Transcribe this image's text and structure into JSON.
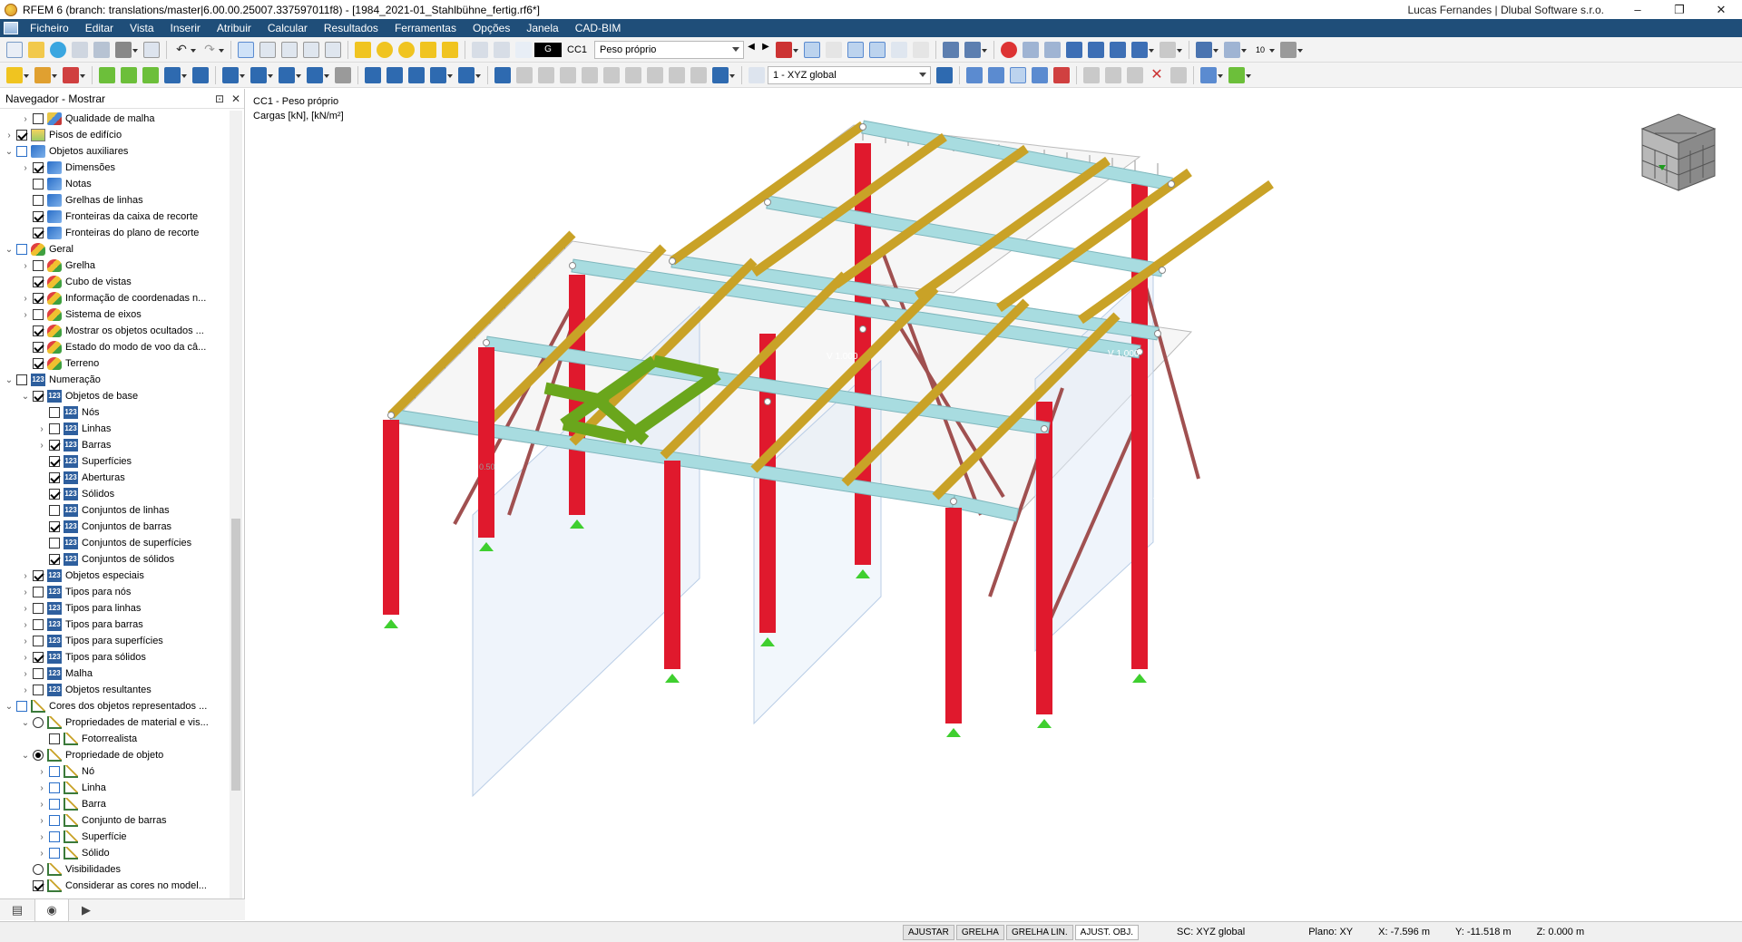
{
  "window": {
    "title": "RFEM 6 (branch: translations/master|6.00.00.25007.337597011f8) - [1984_2021-01_Stahlbühne_fertig.rf6*]",
    "user": "Lucas Fernandes | Dlubal Software s.r.o.",
    "controls": {
      "minimize": "–",
      "restore": "❐",
      "close": "✕"
    }
  },
  "menu": [
    "Ficheiro",
    "Editar",
    "Vista",
    "Inserir",
    "Atribuir",
    "Calcular",
    "Resultados",
    "Ferramentas",
    "Opções",
    "Janela",
    "CAD-BIM"
  ],
  "toolbar": {
    "load_case_tag": "G",
    "load_case_id": "CC1",
    "load_case_name": "Peso próprio",
    "coordinate_system": "1 - XYZ global",
    "numbers_label": "10"
  },
  "navigator": {
    "title": "Navegador - Mostrar",
    "pin": "⊡",
    "close": "✕",
    "items": [
      {
        "level": 1,
        "exp": "›",
        "check": "off",
        "icon": "hm",
        "label": "Qualidade de malha"
      },
      {
        "level": 0,
        "exp": "›",
        "check": "on",
        "icon": "pis",
        "label": "Pisos de edifício"
      },
      {
        "level": 0,
        "exp": "⌄",
        "check": "blue",
        "icon": "bl",
        "label": "Objetos auxiliares"
      },
      {
        "level": 1,
        "exp": "›",
        "check": "on",
        "icon": "bl",
        "label": "Dimensões"
      },
      {
        "level": 1,
        "exp": "",
        "check": "off",
        "icon": "bl",
        "label": "Notas"
      },
      {
        "level": 1,
        "exp": "",
        "check": "off",
        "icon": "bl",
        "label": "Grelhas de linhas"
      },
      {
        "level": 1,
        "exp": "",
        "check": "on",
        "icon": "bl",
        "label": "Fronteiras da caixa de recorte"
      },
      {
        "level": 1,
        "exp": "",
        "check": "on",
        "icon": "bl",
        "label": "Fronteiras do plano de recorte"
      },
      {
        "level": 0,
        "exp": "⌄",
        "check": "blue",
        "icon": "gr",
        "label": "Geral"
      },
      {
        "level": 1,
        "exp": "›",
        "check": "off",
        "icon": "gr",
        "label": "Grelha"
      },
      {
        "level": 1,
        "exp": "",
        "check": "on",
        "icon": "gr",
        "label": "Cubo de vistas"
      },
      {
        "level": 1,
        "exp": "›",
        "check": "on",
        "icon": "gr",
        "label": "Informação de coordenadas n..."
      },
      {
        "level": 1,
        "exp": "›",
        "check": "off",
        "icon": "gr",
        "label": "Sistema de eixos"
      },
      {
        "level": 1,
        "exp": "",
        "check": "on",
        "icon": "gr",
        "label": "Mostrar os objetos ocultados ..."
      },
      {
        "level": 1,
        "exp": "",
        "check": "on",
        "icon": "gr",
        "label": "Estado do modo de voo da câ..."
      },
      {
        "level": 1,
        "exp": "",
        "check": "on",
        "icon": "gr",
        "label": "Terreno"
      },
      {
        "level": 0,
        "exp": "⌄",
        "check": "off",
        "icon": "n123",
        "label": "Numeração"
      },
      {
        "level": 1,
        "exp": "⌄",
        "check": "on",
        "icon": "n123",
        "label": "Objetos de base"
      },
      {
        "level": 2,
        "exp": "",
        "check": "off",
        "icon": "n123",
        "label": "Nós"
      },
      {
        "level": 2,
        "exp": "›",
        "check": "off",
        "icon": "n123",
        "label": "Linhas"
      },
      {
        "level": 2,
        "exp": "›",
        "check": "on",
        "icon": "n123",
        "label": "Barras"
      },
      {
        "level": 2,
        "exp": "",
        "check": "on",
        "icon": "n123",
        "label": "Superfícies"
      },
      {
        "level": 2,
        "exp": "",
        "check": "on",
        "icon": "n123",
        "label": "Aberturas"
      },
      {
        "level": 2,
        "exp": "",
        "check": "on",
        "icon": "n123",
        "label": "Sólidos"
      },
      {
        "level": 2,
        "exp": "",
        "check": "off",
        "icon": "n123",
        "label": "Conjuntos de linhas"
      },
      {
        "level": 2,
        "exp": "",
        "check": "on",
        "icon": "n123",
        "label": "Conjuntos de barras"
      },
      {
        "level": 2,
        "exp": "",
        "check": "off",
        "icon": "n123",
        "label": "Conjuntos de superfícies"
      },
      {
        "level": 2,
        "exp": "",
        "check": "on",
        "icon": "n123",
        "label": "Conjuntos de sólidos"
      },
      {
        "level": 1,
        "exp": "›",
        "check": "on",
        "icon": "n123",
        "label": "Objetos especiais"
      },
      {
        "level": 1,
        "exp": "›",
        "check": "off",
        "icon": "n123",
        "label": "Tipos para nós"
      },
      {
        "level": 1,
        "exp": "›",
        "check": "off",
        "icon": "n123",
        "label": "Tipos para linhas"
      },
      {
        "level": 1,
        "exp": "›",
        "check": "off",
        "icon": "n123",
        "label": "Tipos para barras"
      },
      {
        "level": 1,
        "exp": "›",
        "check": "off",
        "icon": "n123",
        "label": "Tipos para superfícies"
      },
      {
        "level": 1,
        "exp": "›",
        "check": "on",
        "icon": "n123",
        "label": "Tipos para sólidos"
      },
      {
        "level": 1,
        "exp": "›",
        "check": "off",
        "icon": "n123",
        "label": "Malha"
      },
      {
        "level": 1,
        "exp": "›",
        "check": "off",
        "icon": "n123",
        "label": "Objetos resultantes"
      },
      {
        "level": 0,
        "exp": "⌄",
        "check": "blue",
        "icon": "chart",
        "label": "Cores dos objetos representados ..."
      },
      {
        "level": 1,
        "exp": "⌄",
        "check": "radio",
        "icon": "chart",
        "label": "Propriedades de material e vis..."
      },
      {
        "level": 2,
        "exp": "",
        "check": "off",
        "icon": "chart",
        "label": "Fotorrealista"
      },
      {
        "level": 1,
        "exp": "⌄",
        "check": "radio-on",
        "icon": "chart",
        "label": "Propriedade de objeto"
      },
      {
        "level": 2,
        "exp": "›",
        "check": "blue",
        "icon": "chart",
        "label": "Nó"
      },
      {
        "level": 2,
        "exp": "›",
        "check": "blue",
        "icon": "chart",
        "label": "Linha"
      },
      {
        "level": 2,
        "exp": "›",
        "check": "blue",
        "icon": "chart",
        "label": "Barra"
      },
      {
        "level": 2,
        "exp": "›",
        "check": "blue",
        "icon": "chart",
        "label": "Conjunto de barras"
      },
      {
        "level": 2,
        "exp": "›",
        "check": "blue",
        "icon": "chart",
        "label": "Superfície"
      },
      {
        "level": 2,
        "exp": "›",
        "check": "blue",
        "icon": "chart",
        "label": "Sólido"
      },
      {
        "level": 1,
        "exp": "",
        "check": "radio",
        "icon": "chart",
        "label": "Visibilidades"
      },
      {
        "level": 1,
        "exp": "",
        "check": "on",
        "icon": "chart",
        "label": "Considerar as cores no model..."
      }
    ]
  },
  "viewport": {
    "load_case": "CC1 - Peso próprio",
    "load_units": "Cargas [kN], [kN/m²]",
    "value_label": "V 1.000",
    "value_label_small": "0.50"
  },
  "status": {
    "buttons": [
      "AJUSTAR",
      "GRELHA",
      "GRELHA LIN.",
      "AJUST. OBJ."
    ],
    "active_button": "AJUST. OBJ.",
    "cs": "SC: XYZ global",
    "plane": "Plano: XY",
    "x": "X: -7.596 m",
    "y": "Y: -11.518 m",
    "z": "Z: 0.000 m"
  },
  "colors": {
    "menubar": "#1f4e79",
    "column": "#e0192d",
    "beam_main": "#a8dce0",
    "beam_secondary": "#c9a227",
    "opening_frame": "#6aa61c",
    "bracing": "#a05050",
    "support": "#3fcf2f",
    "load": "#9a9a9a"
  }
}
